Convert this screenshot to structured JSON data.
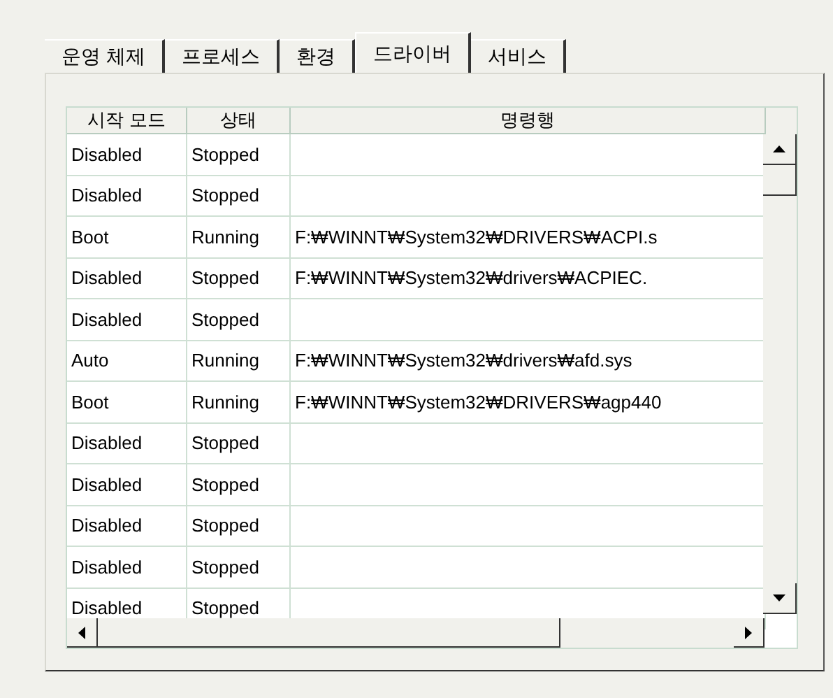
{
  "tabs": [
    {
      "label": "운영 체제",
      "selected": false
    },
    {
      "label": "프로세스",
      "selected": false
    },
    {
      "label": "환경",
      "selected": false
    },
    {
      "label": "드라이버",
      "selected": true
    },
    {
      "label": "서비스",
      "selected": false
    }
  ],
  "table": {
    "columns": [
      "시작 모드",
      "상태",
      "명령행"
    ],
    "rows": [
      {
        "start_mode": "Disabled",
        "status": "Stopped"
      },
      {
        "start_mode": "Disabled",
        "status": "Stopped"
      },
      {
        "start_mode": "Boot",
        "status": "Running",
        "command": "F:₩WINNT₩System32₩DRIVERS₩ACPI.s"
      },
      {
        "start_mode": "Disabled",
        "status": "Stopped",
        "command": "F:₩WINNT₩System32₩drivers₩ACPIEC."
      },
      {
        "start_mode": "Disabled",
        "status": "Stopped"
      },
      {
        "start_mode": "Auto",
        "status": "Running",
        "command": "F:₩WINNT₩System32₩drivers₩afd.sys"
      },
      {
        "start_mode": "Boot",
        "status": "Running",
        "command": "F:₩WINNT₩System32₩DRIVERS₩agp440"
      },
      {
        "start_mode": "Disabled",
        "status": "Stopped"
      },
      {
        "start_mode": "Disabled",
        "status": "Stopped"
      },
      {
        "start_mode": "Disabled",
        "status": "Stopped"
      },
      {
        "start_mode": "Disabled",
        "status": "Stopped"
      },
      {
        "start_mode": "Disabled",
        "status": "Stopped"
      }
    ]
  }
}
